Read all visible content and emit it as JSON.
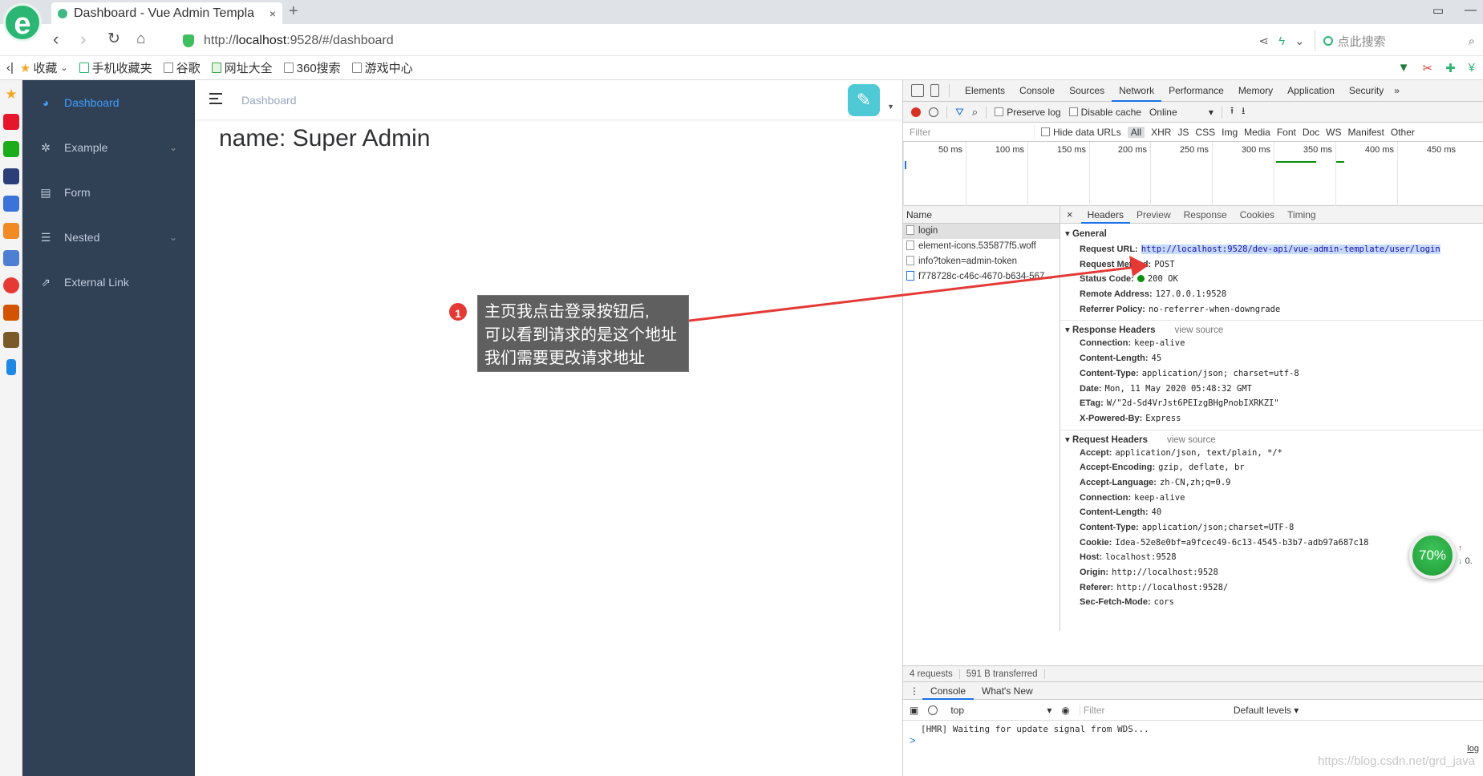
{
  "browser": {
    "logo": "e",
    "tab_title": "Dashboard - Vue Admin Templa",
    "tab_close": "×",
    "new_tab": "+",
    "url_prefix": "http://",
    "url_host": "localhost",
    "url_rest": ":9528/#/dashboard",
    "search_placeholder": "点此搜索",
    "bookmarks": [
      "收藏",
      "手机收藏夹",
      "谷歌",
      "网址大全",
      "360搜索",
      "游戏中心"
    ]
  },
  "app": {
    "menu": [
      {
        "label": "Dashboard",
        "icon": "dashboard-icon",
        "active": true
      },
      {
        "label": "Example",
        "icon": "example-icon",
        "expandable": true
      },
      {
        "label": "Form",
        "icon": "form-icon"
      },
      {
        "label": "Nested",
        "icon": "nested-icon",
        "expandable": true
      },
      {
        "label": "External Link",
        "icon": "link-icon"
      }
    ],
    "breadcrumb": "Dashboard",
    "dashboard_text": "name: Super Admin"
  },
  "annotation": {
    "number": "1",
    "lines": [
      "主页我点击登录按钮后,",
      "可以看到请求的是这个地址",
      "我们需要更改请求地址"
    ]
  },
  "devtools": {
    "tabs": [
      "Elements",
      "Console",
      "Sources",
      "Network",
      "Performance",
      "Memory",
      "Application",
      "Security"
    ],
    "selected_tab": "Network",
    "more": "»",
    "toolbar": {
      "preserve_log": "Preserve log",
      "disable_cache": "Disable cache",
      "throttling": "Online"
    },
    "filter": {
      "placeholder": "Filter",
      "hide_data_urls": "Hide data URLs",
      "types": [
        "All",
        "XHR",
        "JS",
        "CSS",
        "Img",
        "Media",
        "Font",
        "Doc",
        "WS",
        "Manifest",
        "Other"
      ]
    },
    "timeline_ticks": [
      "50 ms",
      "100 ms",
      "150 ms",
      "200 ms",
      "250 ms",
      "300 ms",
      "350 ms",
      "400 ms",
      "450 ms"
    ],
    "name_header": "Name",
    "requests": [
      "login",
      "element-icons.535877f5.woff",
      "info?token=admin-token",
      "f778728c-c46c-4670-b634-567..."
    ],
    "detail_tabs": [
      "Headers",
      "Preview",
      "Response",
      "Cookies",
      "Timing"
    ],
    "general": {
      "title": "General",
      "rows": [
        {
          "k": "Request URL:",
          "v": "http://localhost:9528/dev-api/vue-admin-template/user/login"
        },
        {
          "k": "Request Method:",
          "v": "POST"
        },
        {
          "k": "Status Code:",
          "v": "200 OK"
        },
        {
          "k": "Remote Address:",
          "v": "127.0.0.1:9528"
        },
        {
          "k": "Referrer Policy:",
          "v": "no-referrer-when-downgrade"
        }
      ]
    },
    "response_headers": {
      "title": "Response Headers",
      "view_source": "view source",
      "rows": [
        {
          "k": "Connection:",
          "v": "keep-alive"
        },
        {
          "k": "Content-Length:",
          "v": "45"
        },
        {
          "k": "Content-Type:",
          "v": "application/json; charset=utf-8"
        },
        {
          "k": "Date:",
          "v": "Mon, 11 May 2020 05:48:32 GMT"
        },
        {
          "k": "ETag:",
          "v": "W/\"2d-Sd4VrJst6PEIzgBHgPnobIXRKZI\""
        },
        {
          "k": "X-Powered-By:",
          "v": "Express"
        }
      ]
    },
    "request_headers": {
      "title": "Request Headers",
      "view_source": "view source",
      "rows": [
        {
          "k": "Accept:",
          "v": "application/json, text/plain, */*"
        },
        {
          "k": "Accept-Encoding:",
          "v": "gzip, deflate, br"
        },
        {
          "k": "Accept-Language:",
          "v": "zh-CN,zh;q=0.9"
        },
        {
          "k": "Connection:",
          "v": "keep-alive"
        },
        {
          "k": "Content-Length:",
          "v": "40"
        },
        {
          "k": "Content-Type:",
          "v": "application/json;charset=UTF-8"
        },
        {
          "k": "Cookie:",
          "v": "Idea-52e8e0bf=a9fcec49-6c13-4545-b3b7-adb97a687c18"
        },
        {
          "k": "Host:",
          "v": "localhost:9528"
        },
        {
          "k": "Origin:",
          "v": "http://localhost:9528"
        },
        {
          "k": "Referer:",
          "v": "http://localhost:9528/"
        },
        {
          "k": "Sec-Fetch-Mode:",
          "v": "cors"
        }
      ]
    },
    "summary": {
      "requests": "4 requests",
      "transferred": "591 B transferred"
    },
    "drawer_tabs": [
      "Console",
      "What's New"
    ],
    "console": {
      "context": "top",
      "filter": "Filter",
      "levels": "Default levels ▾",
      "message": "[HMR] Waiting for update signal from WDS...",
      "source": "log",
      "prompt": ">"
    }
  },
  "overlay": {
    "speed": "70%",
    "speed_side": "0."
  },
  "watermark": "https://blog.csdn.net/grd_java",
  "colors": {
    "sidebar_bg": "#304156",
    "active_menu": "#409eff",
    "annotation_red": "#e53935"
  }
}
